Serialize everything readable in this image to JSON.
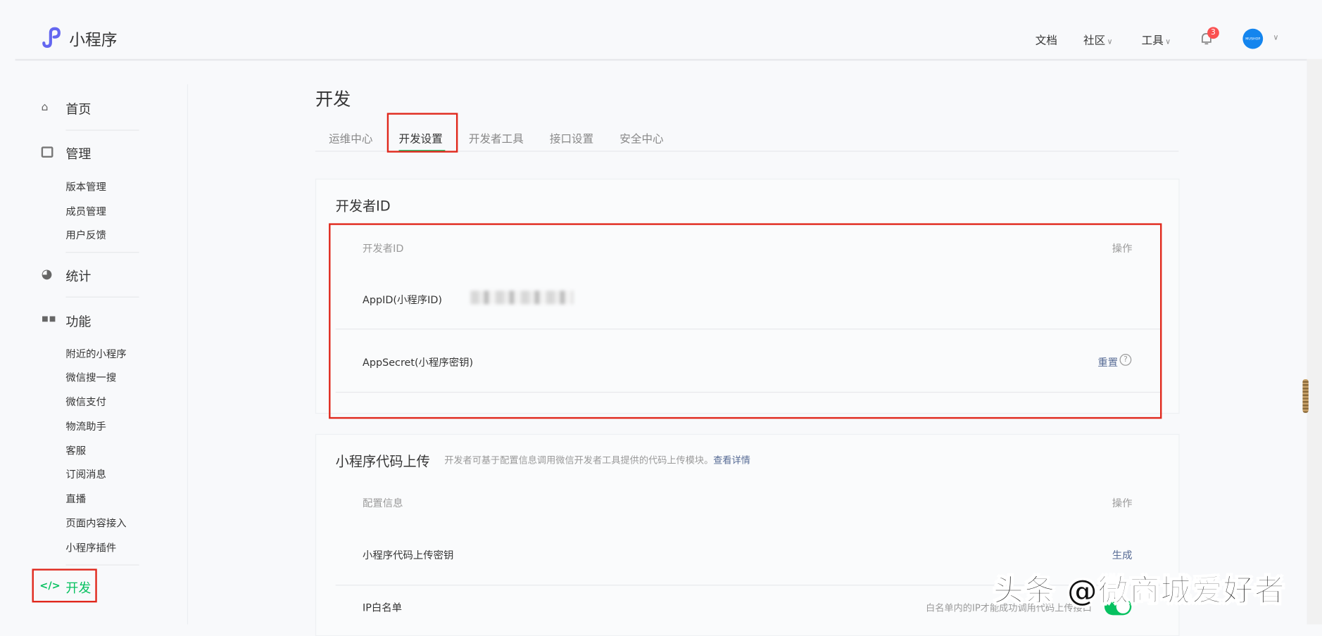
{
  "header": {
    "app_name": "小程序",
    "nav": {
      "docs": "文档",
      "community": "社区",
      "tools": "工具"
    },
    "notification_count": "3",
    "avatar_text": "MUSHOP"
  },
  "sidebar": {
    "home": "首页",
    "manage": "管理",
    "manage_items": [
      "版本管理",
      "成员管理",
      "用户反馈"
    ],
    "stats": "统计",
    "features": "功能",
    "feature_items": [
      "附近的小程序",
      "微信搜一搜",
      "微信支付",
      "物流助手",
      "客服",
      "订阅消息",
      "直播",
      "页面内容接入",
      "小程序插件"
    ],
    "develop": "开发"
  },
  "main": {
    "title": "开发",
    "tabs": [
      "运维中心",
      "开发设置",
      "开发者工具",
      "接口设置",
      "安全中心"
    ],
    "active_tab": "开发设置",
    "dev_id": {
      "title": "开发者ID",
      "col_name": "开发者ID",
      "col_action": "操作",
      "rows": [
        {
          "label": "AppID(小程序ID)",
          "value": ""
        },
        {
          "label": "AppSecret(小程序密钥)",
          "action": "重置"
        }
      ]
    },
    "upload": {
      "title": "小程序代码上传",
      "desc": "开发者可基于配置信息调用微信开发者工具提供的代码上传模块。",
      "desc_link": "查看详情",
      "col_name": "配置信息",
      "col_action": "操作",
      "rows": [
        {
          "label": "小程序代码上传密钥",
          "action": "生成"
        },
        {
          "label": "IP白名单",
          "note": "白名单内的IP才能成功调用代码上传接口",
          "enabled": true
        }
      ]
    }
  },
  "watermark": "头条 @微商城爱好者",
  "colors": {
    "accent": "#07c160",
    "link": "#576b95",
    "highlight": "#e0281c"
  }
}
